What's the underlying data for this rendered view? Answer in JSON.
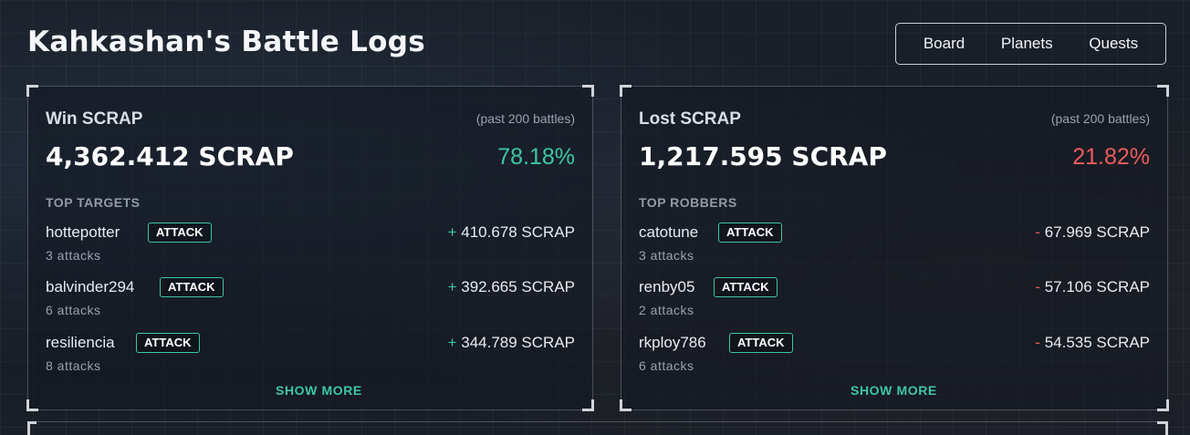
{
  "header": {
    "title": "Kahkashan's Battle Logs",
    "nav": [
      "Board",
      "Planets",
      "Quests"
    ]
  },
  "win_card": {
    "title": "Win SCRAP",
    "period": "(past 200 battles)",
    "total": "4,362.412 SCRAP",
    "percent": "78.18%",
    "section_label": "TOP TARGETS",
    "attack_label": "ATTACK",
    "sign": "+",
    "rows": [
      {
        "name": "hottepotter",
        "count": "3 attacks",
        "amount": "410.678 SCRAP"
      },
      {
        "name": "balvinder294",
        "count": "6 attacks",
        "amount": "392.665 SCRAP"
      },
      {
        "name": "resiliencia",
        "count": "8 attacks",
        "amount": "344.789 SCRAP"
      }
    ],
    "show_more": "SHOW MORE"
  },
  "loss_card": {
    "title": "Lost SCRAP",
    "period": "(past 200 battles)",
    "total": "1,217.595 SCRAP",
    "percent": "21.82%",
    "section_label": "TOP ROBBERS",
    "attack_label": "ATTACK",
    "sign": "-",
    "rows": [
      {
        "name": "catotune",
        "count": "3 attacks",
        "amount": "67.969 SCRAP"
      },
      {
        "name": "renby05",
        "count": "2 attacks",
        "amount": "57.106 SCRAP"
      },
      {
        "name": "rkploy786",
        "count": "6 attacks",
        "amount": "54.535 SCRAP"
      }
    ],
    "show_more": "SHOW MORE"
  },
  "colors": {
    "accent": "#3ec6a3",
    "loss": "#ec5c5c",
    "background": "#161b23"
  }
}
